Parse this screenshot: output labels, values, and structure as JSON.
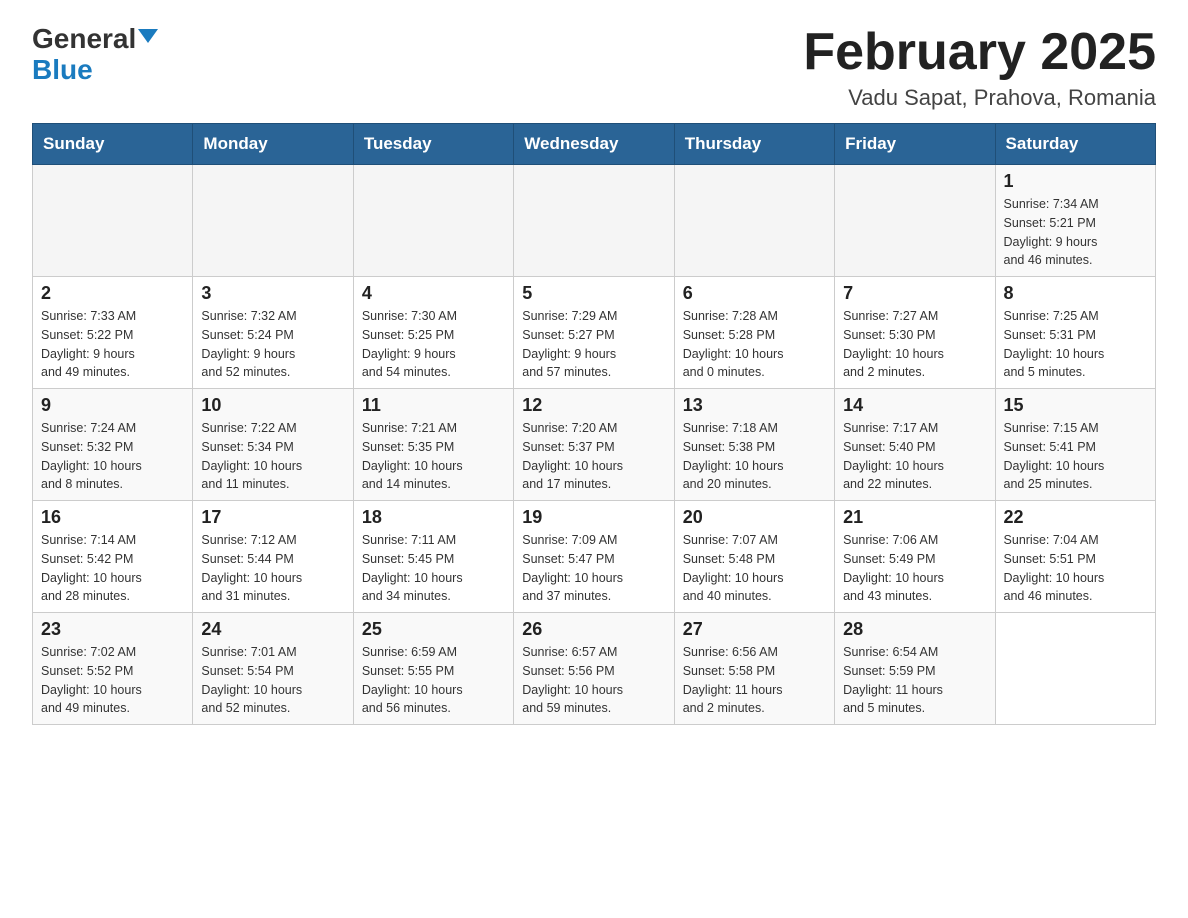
{
  "header": {
    "logo_general": "General",
    "logo_blue": "Blue",
    "month_title": "February 2025",
    "location": "Vadu Sapat, Prahova, Romania"
  },
  "weekdays": [
    "Sunday",
    "Monday",
    "Tuesday",
    "Wednesday",
    "Thursday",
    "Friday",
    "Saturday"
  ],
  "weeks": [
    [
      {
        "day": "",
        "info": ""
      },
      {
        "day": "",
        "info": ""
      },
      {
        "day": "",
        "info": ""
      },
      {
        "day": "",
        "info": ""
      },
      {
        "day": "",
        "info": ""
      },
      {
        "day": "",
        "info": ""
      },
      {
        "day": "1",
        "info": "Sunrise: 7:34 AM\nSunset: 5:21 PM\nDaylight: 9 hours\nand 46 minutes."
      }
    ],
    [
      {
        "day": "2",
        "info": "Sunrise: 7:33 AM\nSunset: 5:22 PM\nDaylight: 9 hours\nand 49 minutes."
      },
      {
        "day": "3",
        "info": "Sunrise: 7:32 AM\nSunset: 5:24 PM\nDaylight: 9 hours\nand 52 minutes."
      },
      {
        "day": "4",
        "info": "Sunrise: 7:30 AM\nSunset: 5:25 PM\nDaylight: 9 hours\nand 54 minutes."
      },
      {
        "day": "5",
        "info": "Sunrise: 7:29 AM\nSunset: 5:27 PM\nDaylight: 9 hours\nand 57 minutes."
      },
      {
        "day": "6",
        "info": "Sunrise: 7:28 AM\nSunset: 5:28 PM\nDaylight: 10 hours\nand 0 minutes."
      },
      {
        "day": "7",
        "info": "Sunrise: 7:27 AM\nSunset: 5:30 PM\nDaylight: 10 hours\nand 2 minutes."
      },
      {
        "day": "8",
        "info": "Sunrise: 7:25 AM\nSunset: 5:31 PM\nDaylight: 10 hours\nand 5 minutes."
      }
    ],
    [
      {
        "day": "9",
        "info": "Sunrise: 7:24 AM\nSunset: 5:32 PM\nDaylight: 10 hours\nand 8 minutes."
      },
      {
        "day": "10",
        "info": "Sunrise: 7:22 AM\nSunset: 5:34 PM\nDaylight: 10 hours\nand 11 minutes."
      },
      {
        "day": "11",
        "info": "Sunrise: 7:21 AM\nSunset: 5:35 PM\nDaylight: 10 hours\nand 14 minutes."
      },
      {
        "day": "12",
        "info": "Sunrise: 7:20 AM\nSunset: 5:37 PM\nDaylight: 10 hours\nand 17 minutes."
      },
      {
        "day": "13",
        "info": "Sunrise: 7:18 AM\nSunset: 5:38 PM\nDaylight: 10 hours\nand 20 minutes."
      },
      {
        "day": "14",
        "info": "Sunrise: 7:17 AM\nSunset: 5:40 PM\nDaylight: 10 hours\nand 22 minutes."
      },
      {
        "day": "15",
        "info": "Sunrise: 7:15 AM\nSunset: 5:41 PM\nDaylight: 10 hours\nand 25 minutes."
      }
    ],
    [
      {
        "day": "16",
        "info": "Sunrise: 7:14 AM\nSunset: 5:42 PM\nDaylight: 10 hours\nand 28 minutes."
      },
      {
        "day": "17",
        "info": "Sunrise: 7:12 AM\nSunset: 5:44 PM\nDaylight: 10 hours\nand 31 minutes."
      },
      {
        "day": "18",
        "info": "Sunrise: 7:11 AM\nSunset: 5:45 PM\nDaylight: 10 hours\nand 34 minutes."
      },
      {
        "day": "19",
        "info": "Sunrise: 7:09 AM\nSunset: 5:47 PM\nDaylight: 10 hours\nand 37 minutes."
      },
      {
        "day": "20",
        "info": "Sunrise: 7:07 AM\nSunset: 5:48 PM\nDaylight: 10 hours\nand 40 minutes."
      },
      {
        "day": "21",
        "info": "Sunrise: 7:06 AM\nSunset: 5:49 PM\nDaylight: 10 hours\nand 43 minutes."
      },
      {
        "day": "22",
        "info": "Sunrise: 7:04 AM\nSunset: 5:51 PM\nDaylight: 10 hours\nand 46 minutes."
      }
    ],
    [
      {
        "day": "23",
        "info": "Sunrise: 7:02 AM\nSunset: 5:52 PM\nDaylight: 10 hours\nand 49 minutes."
      },
      {
        "day": "24",
        "info": "Sunrise: 7:01 AM\nSunset: 5:54 PM\nDaylight: 10 hours\nand 52 minutes."
      },
      {
        "day": "25",
        "info": "Sunrise: 6:59 AM\nSunset: 5:55 PM\nDaylight: 10 hours\nand 56 minutes."
      },
      {
        "day": "26",
        "info": "Sunrise: 6:57 AM\nSunset: 5:56 PM\nDaylight: 10 hours\nand 59 minutes."
      },
      {
        "day": "27",
        "info": "Sunrise: 6:56 AM\nSunset: 5:58 PM\nDaylight: 11 hours\nand 2 minutes."
      },
      {
        "day": "28",
        "info": "Sunrise: 6:54 AM\nSunset: 5:59 PM\nDaylight: 11 hours\nand 5 minutes."
      },
      {
        "day": "",
        "info": ""
      }
    ]
  ]
}
